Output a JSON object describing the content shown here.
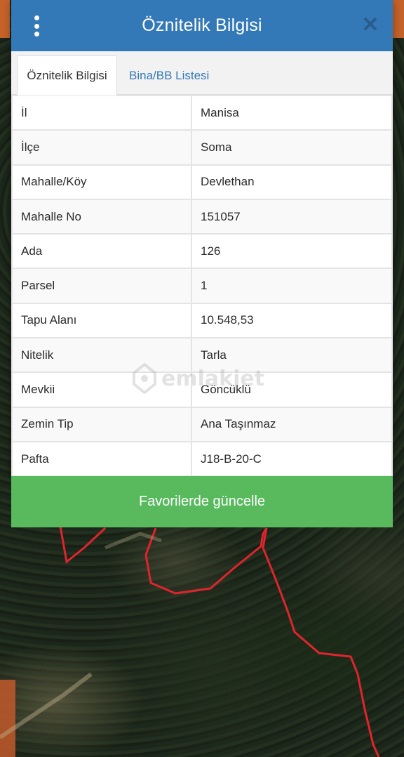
{
  "header": {
    "title": "Öznitelik Bilgisi",
    "menu_icon": "more-vertical-icon",
    "close_icon": "close-icon",
    "accent": "#3479b7"
  },
  "tabs": [
    {
      "label": "Öznitelik Bilgisi",
      "active": true
    },
    {
      "label": "Bina/BB Listesi",
      "active": false
    }
  ],
  "attributes": [
    {
      "key": "İl",
      "value": "Manisa"
    },
    {
      "key": "İlçe",
      "value": "Soma"
    },
    {
      "key": "Mahalle/Köy",
      "value": "Devlethan"
    },
    {
      "key": "Mahalle No",
      "value": "151057"
    },
    {
      "key": "Ada",
      "value": "126"
    },
    {
      "key": "Parsel",
      "value": "1"
    },
    {
      "key": "Tapu Alanı",
      "value": "10.548,53"
    },
    {
      "key": "Nitelik",
      "value": "Tarla"
    },
    {
      "key": "Mevkii",
      "value": "Göncüklü"
    },
    {
      "key": "Zemin Tip",
      "value": "Ana Taşınmaz"
    },
    {
      "key": "Pafta",
      "value": "J18-B-20-C"
    }
  ],
  "watermark": {
    "text": "emlakjet"
  },
  "footer": {
    "button_label": "Favorilerde güncelle",
    "button_color": "#58b95d"
  },
  "map": {
    "parcel_color": "#e0242d"
  }
}
